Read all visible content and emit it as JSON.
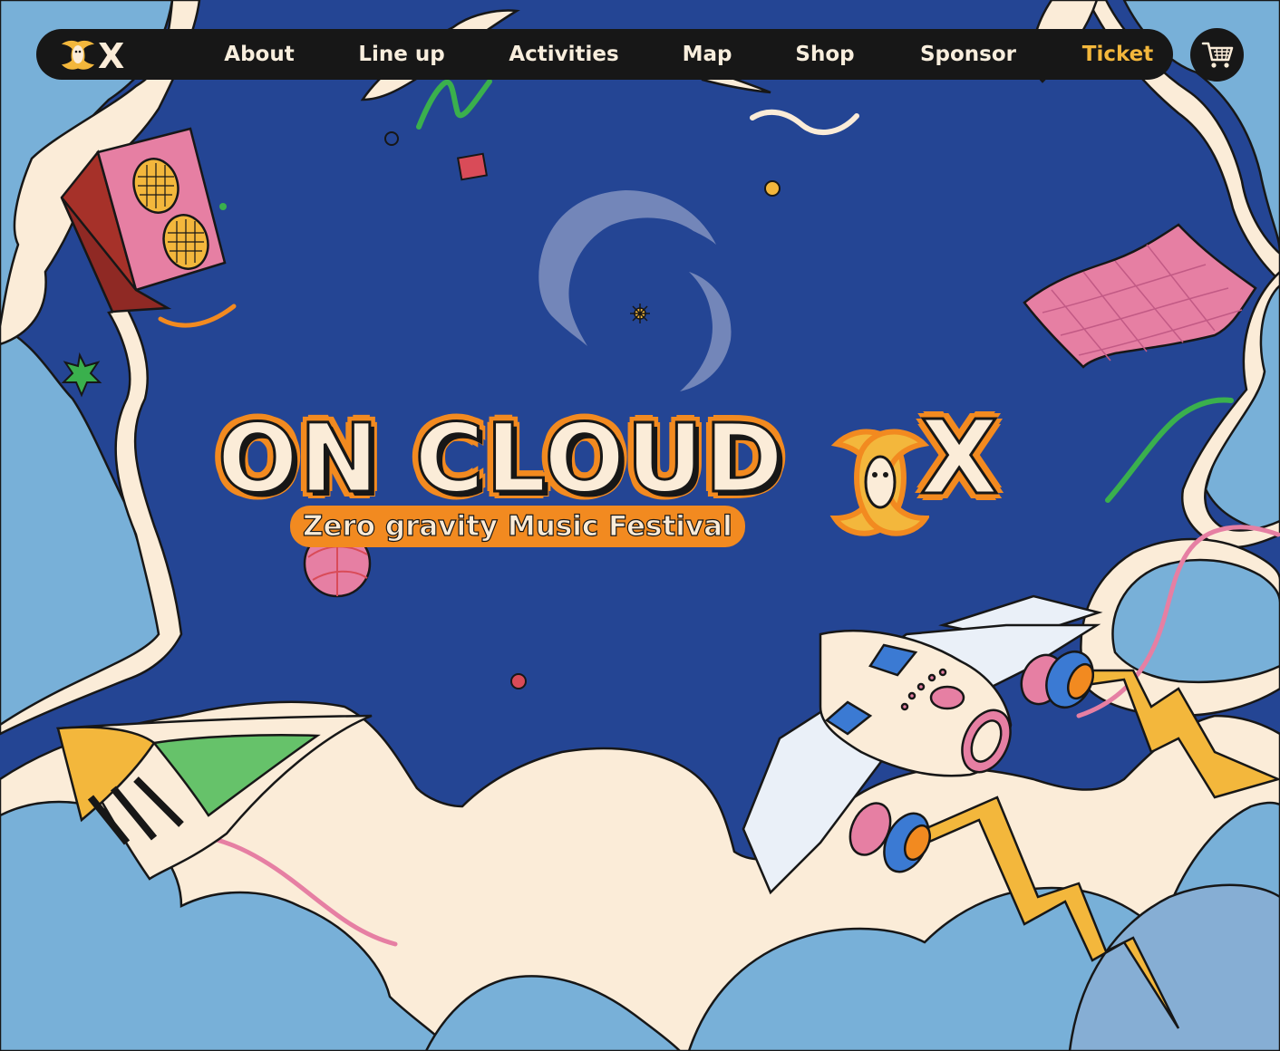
{
  "nav": {
    "items": [
      {
        "label": "About",
        "name": "nav-item-about"
      },
      {
        "label": "Line up",
        "name": "nav-item-line-up"
      },
      {
        "label": "Activities",
        "name": "nav-item-activities"
      },
      {
        "label": "Map",
        "name": "nav-item-map"
      },
      {
        "label": "Shop",
        "name": "nav-item-shop"
      },
      {
        "label": "Sponsor",
        "name": "nav-item-sponsor"
      },
      {
        "label": "Ticket",
        "name": "nav-item-ticket"
      }
    ],
    "logo_letter": "X",
    "cart_icon": "shopping-cart-icon"
  },
  "hero": {
    "title": "ON CLOUD",
    "title_x": "X",
    "subtitle": "Zero gravity Music Festival"
  },
  "colors": {
    "sky": "#244594",
    "cloud_blue": "#78b0d8",
    "cloud_cream": "#fbecd8",
    "nav_bg": "#171717",
    "accent_orange": "#f28a20",
    "accent_yellow": "#f3b73c",
    "pink": "#e67fa3"
  }
}
